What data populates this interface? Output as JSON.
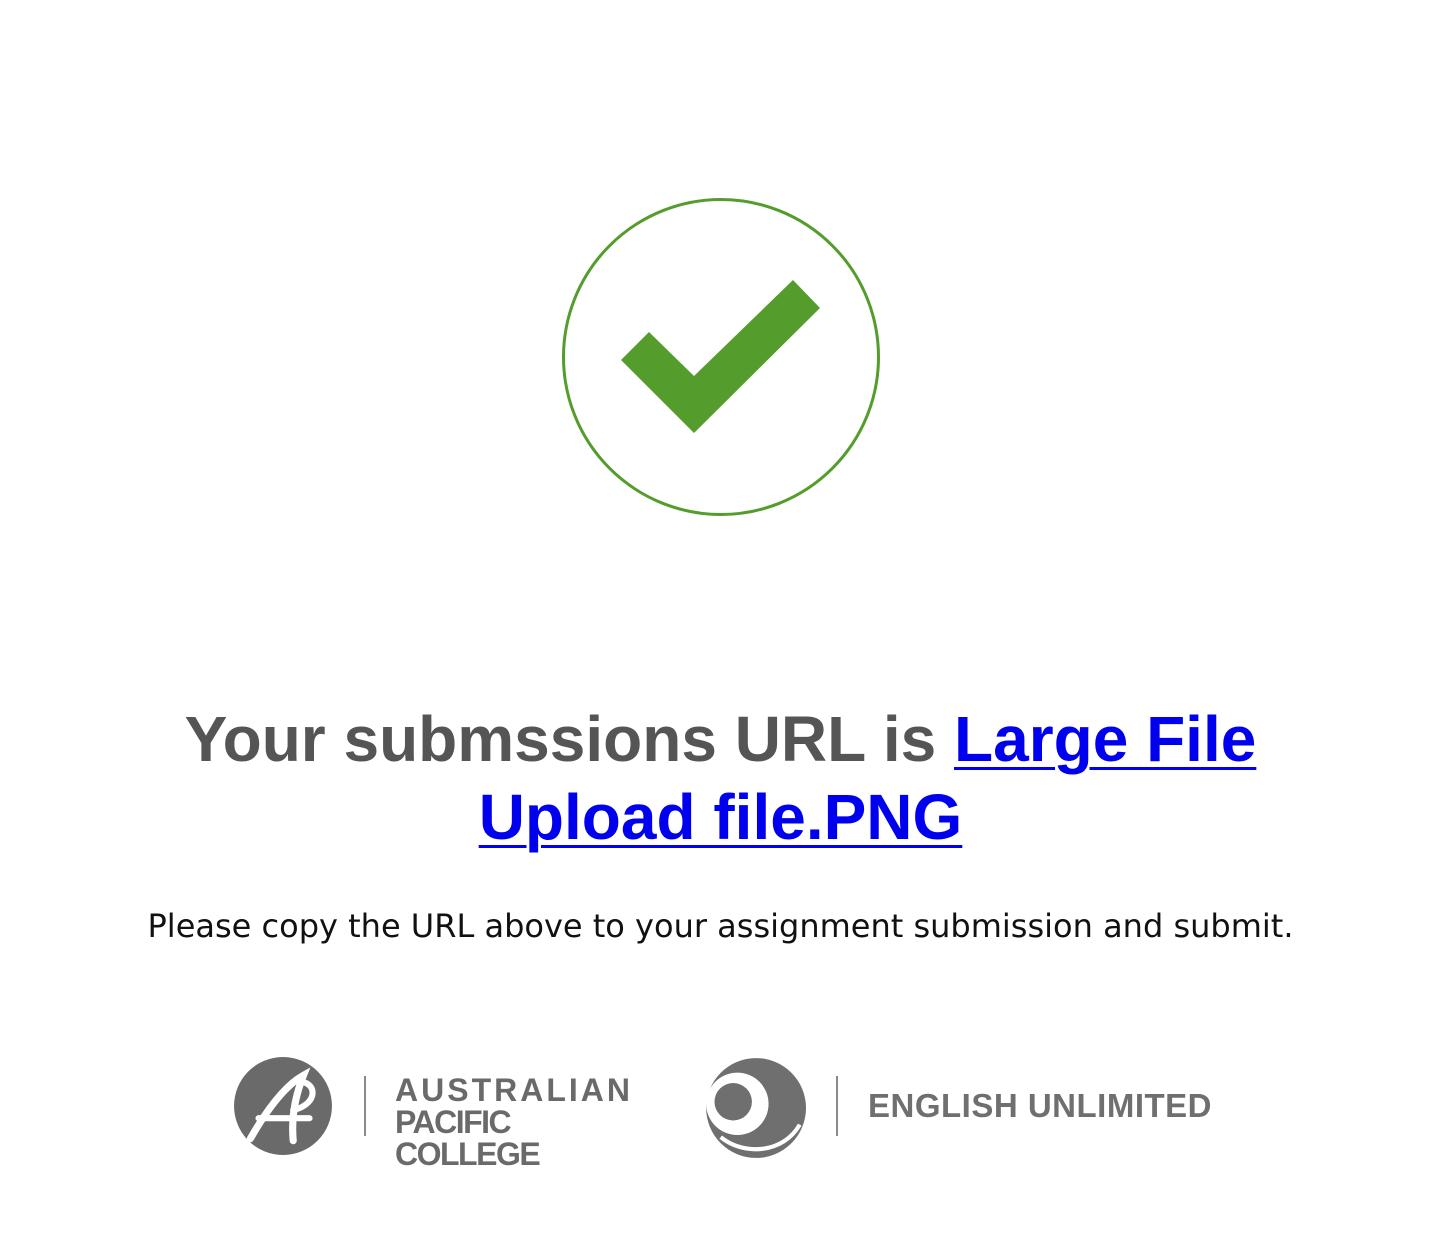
{
  "status": {
    "icon": "checkmark-circle-icon",
    "color": "#549d2c"
  },
  "headline": {
    "prefix": "Your submssions URL is ",
    "link_text": "Large File Upload file.PNG"
  },
  "instruction": "Please copy the URL above to your assignment submission and submit.",
  "footer": {
    "apc_logo_icon": "australian-pacific-college-logo-icon",
    "apc_name_line1": "AUSTRALIAN",
    "apc_name_line2": "PACIFIC COLLEGE",
    "eu_logo_icon": "english-unlimited-logo-icon",
    "eu_name": "ENGLISH UNLIMITED"
  }
}
